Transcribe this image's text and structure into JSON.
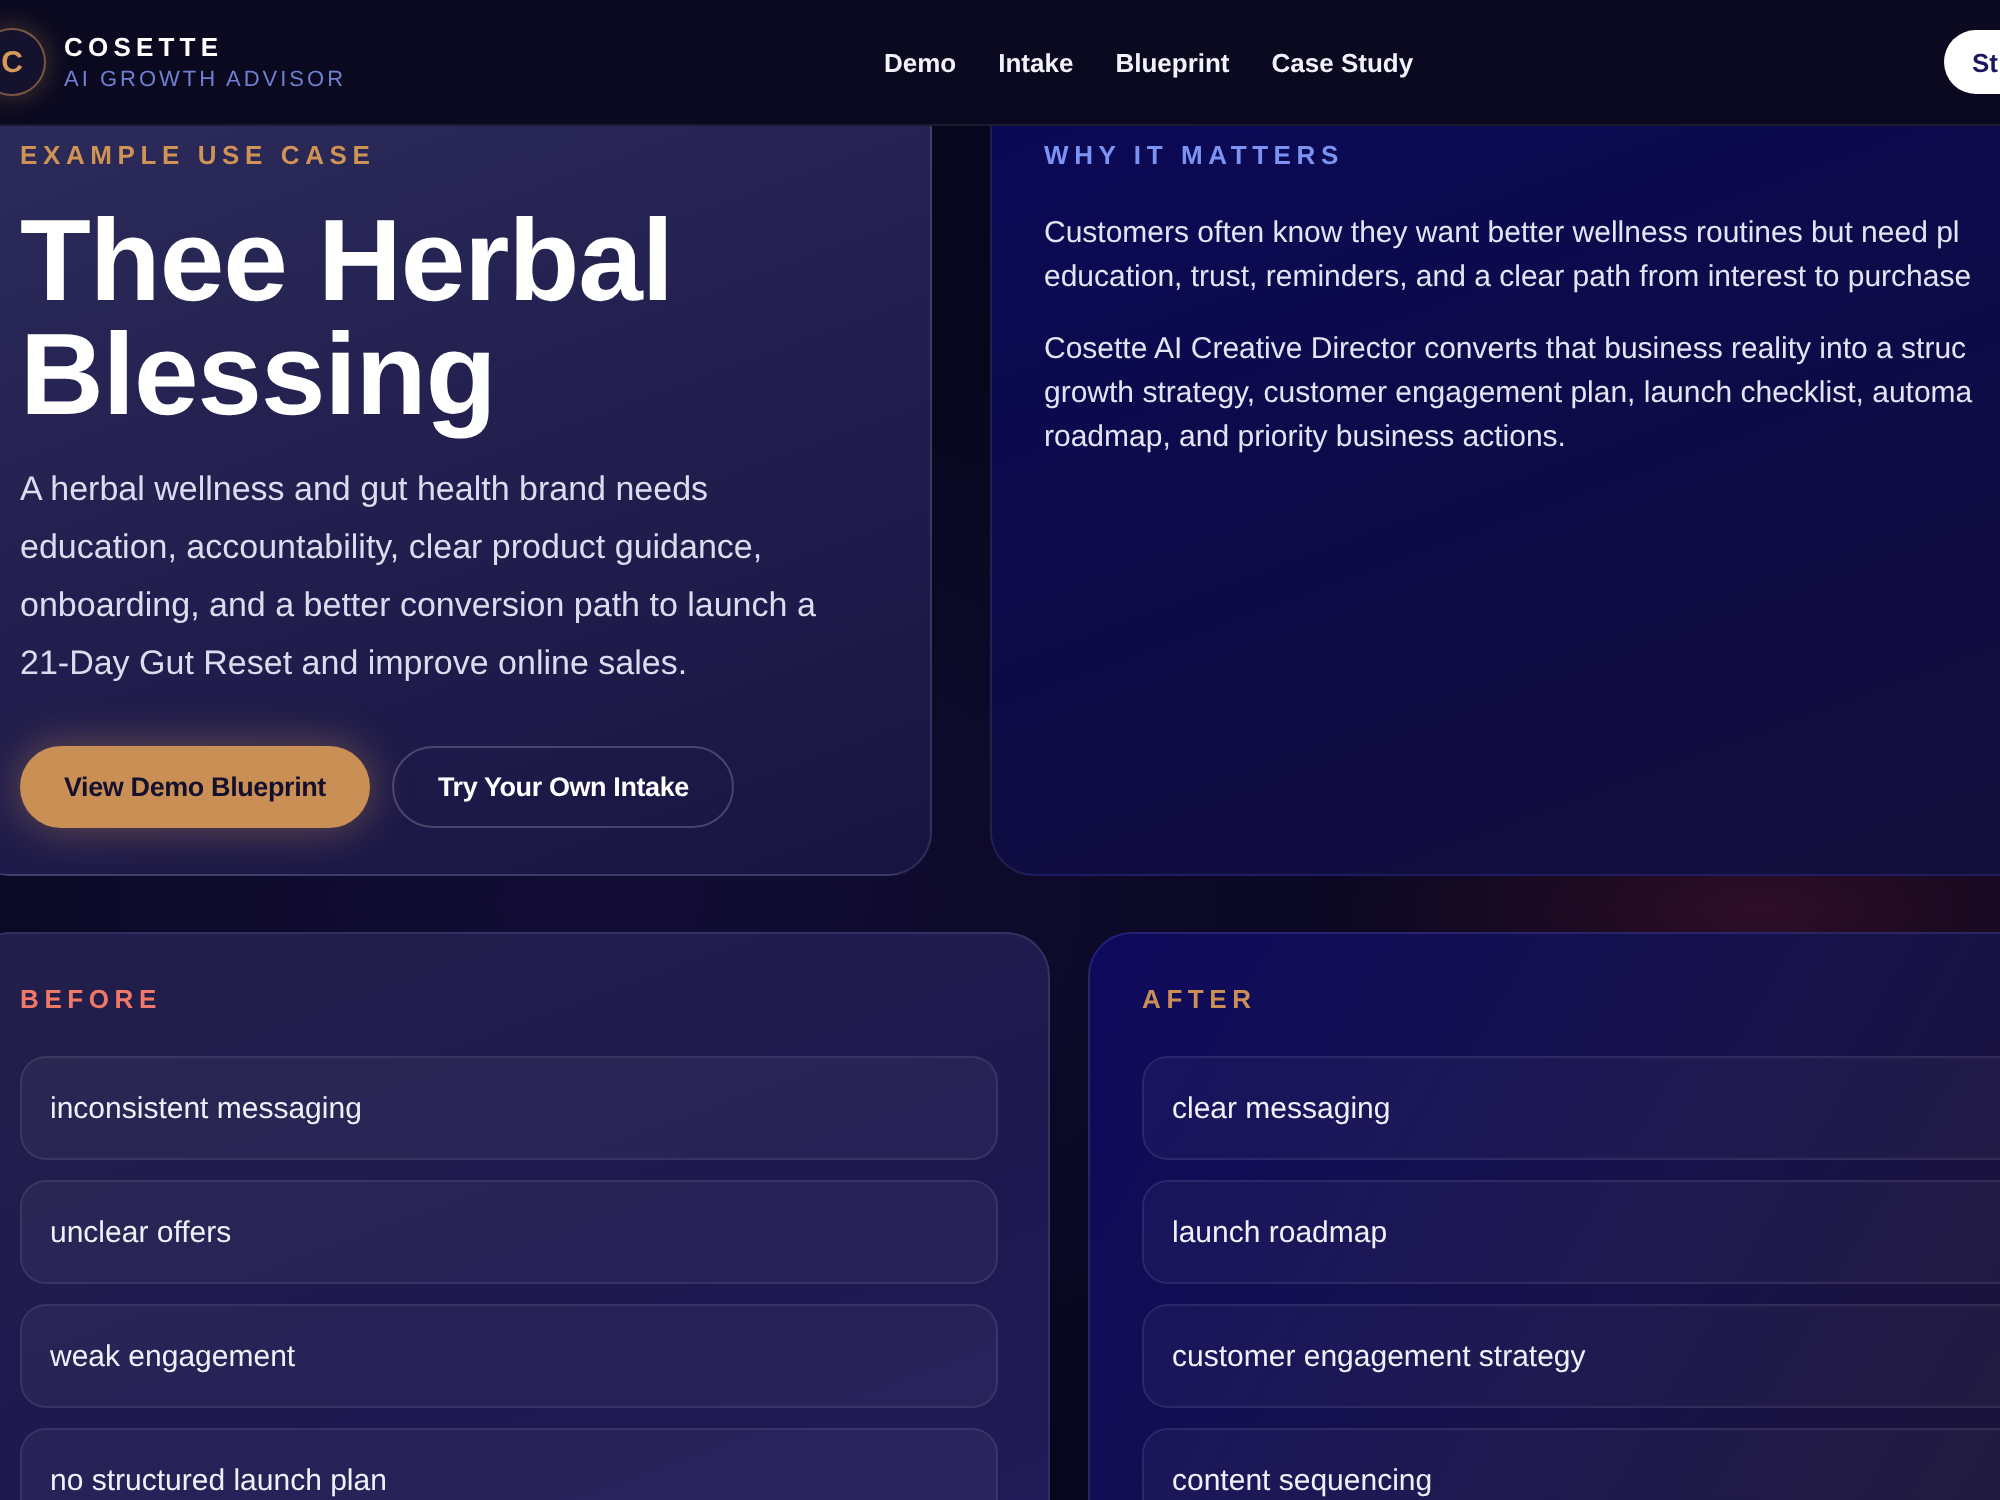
{
  "header": {
    "logo_letter": "C",
    "brand": "COSETTE",
    "tagline": "AI GROWTH ADVISOR",
    "nav": [
      {
        "label": "Demo"
      },
      {
        "label": "Intake"
      },
      {
        "label": "Blueprint"
      },
      {
        "label": "Case Study"
      }
    ],
    "cta": "St"
  },
  "hero": {
    "eyebrow": "EXAMPLE USE CASE",
    "title": "Thee Herbal Blessing",
    "description": "A herbal wellness and gut health brand needs education, accountability, clear product guidance, onboarding, and a better conversion path to launch a 21-Day Gut Reset and improve online sales.",
    "buttons": [
      {
        "label": "View Demo Blueprint",
        "kind": "primary"
      },
      {
        "label": "Try Your Own Intake",
        "kind": "secondary"
      }
    ]
  },
  "why_it_matters": {
    "eyebrow": "WHY IT MATTERS",
    "paragraphs": [
      {
        "lines": [
          "Customers often know they want better wellness routines but need pl",
          "education, trust, reminders, and a clear path from interest to purchase"
        ]
      },
      {
        "lines": [
          "Cosette AI Creative Director converts that business reality into a struc",
          "growth strategy, customer engagement plan, launch checklist, automa",
          "roadmap, and priority business actions."
        ]
      }
    ]
  },
  "comparison": [
    {
      "kind": "before",
      "heading": "BEFORE",
      "items": [
        "inconsistent messaging",
        "unclear offers",
        "weak engagement",
        "no structured launch plan"
      ]
    },
    {
      "kind": "after",
      "heading": "AFTER",
      "items": [
        "clear messaging",
        "launch roadmap",
        "customer engagement strategy",
        "content sequencing"
      ]
    }
  ]
}
